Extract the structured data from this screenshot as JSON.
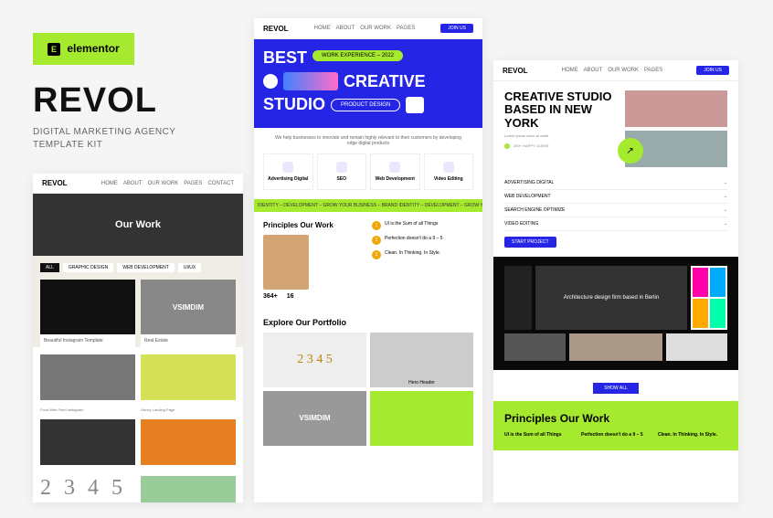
{
  "badge": {
    "icon": "E",
    "text": "elementor"
  },
  "brand": {
    "name": "REVOL",
    "tagline": "DIGITAL MARKETING AGENCY TEMPLATE KIT"
  },
  "nav": {
    "items": [
      "HOME",
      "ABOUT",
      "OUR WORK",
      "PAGES",
      "CONTACT"
    ],
    "cta": "JOIN US"
  },
  "p1": {
    "logo": "REVOL",
    "hero": "Our Work",
    "tabs": [
      "ALL",
      "GRAPHIC DESIGN",
      "WEB DEVELOPMENT",
      "UI/UX"
    ],
    "cards": [
      {
        "title": "Beautiful Instagram Template"
      },
      {
        "title": "VSIMDIM",
        "sub": "Real Estate"
      }
    ],
    "caps": [
      "Food Web Feed Instagram",
      "Honey Landing Page"
    ],
    "numbers": "2 3 4 5"
  },
  "p2": {
    "logo": "REVOL",
    "pill": "WORK EXPERIENCE – 2022",
    "big1": "BEST",
    "big2": "CREATIVE",
    "big3": "STUDIO",
    "pill2": "PRODUCT DESIGN",
    "desc": "We help businesses to innovate and remain highly relevant to their customers by developing edge digital products",
    "services": [
      "Advertising Digital",
      "SEO",
      "Web Development",
      "Video Editing"
    ],
    "marquee": "IDENTITY – DEVELOPMENT – GROW YOUR BUSINESS – BRAND IDENTITY – DEVELOPMENT – GROW YOUR BUSINESS –",
    "principles_title": "Principles Our Work",
    "stats": [
      {
        "n": "364+"
      },
      {
        "n": "16"
      }
    ],
    "pr_items": [
      {
        "n": "1",
        "t": "UI is the Sum of all Things"
      },
      {
        "n": "2",
        "t": "Perfection doesn't do a 9 – 5"
      },
      {
        "n": "3",
        "t": "Clean. In Thinking. In Style."
      }
    ],
    "portfolio_title": "Explore Our Portfolio",
    "port_labels": [
      "2 3 4 5",
      "Hero Header",
      "VSIMDIM",
      ""
    ]
  },
  "p3": {
    "logo": "REVOL",
    "hero_title": "CREATIVE STUDIO BASED IN NEW YORK",
    "meta": "200+  HAPPY CLIENT",
    "list": [
      "ADVERTISING DIGITAL",
      "WEB DEVELOPMENT",
      "SEARCH ENGINE OPTIMIZE",
      "VIDEO EDITING"
    ],
    "start": "START PROJECT",
    "work_label": "Architecture design firm based in Berlin",
    "showall": "SHOW ALL",
    "prin_title": "Principles Our Work",
    "prin_cols": [
      {
        "h": "UI is the Sum of all Things"
      },
      {
        "h": "Perfection doesn't do a 9 – 5"
      },
      {
        "h": "Clean. In Thinking. In Style."
      }
    ]
  }
}
